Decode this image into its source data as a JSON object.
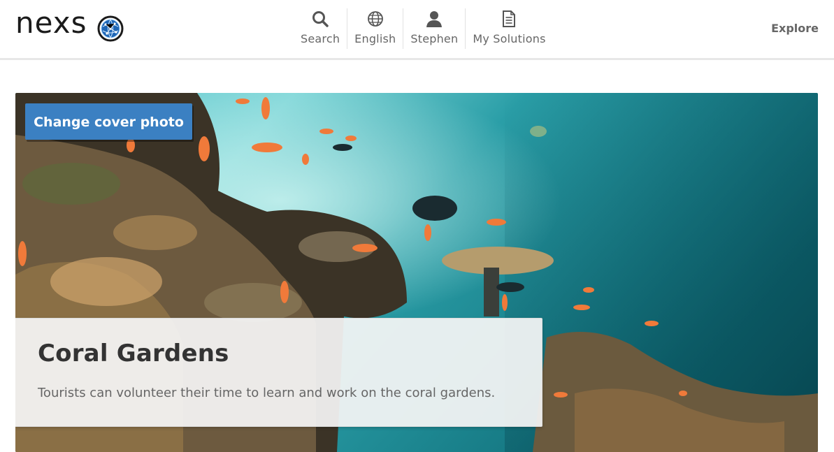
{
  "header": {
    "logo_text": "nexs",
    "nav": [
      {
        "label": "Search",
        "icon": "search-icon"
      },
      {
        "label": "English",
        "icon": "globe-icon"
      },
      {
        "label": "Stephen",
        "icon": "user-icon"
      },
      {
        "label": "My Solutions",
        "icon": "document-icon"
      }
    ],
    "explore_label": "Explore"
  },
  "cover": {
    "change_button_label": "Change cover photo",
    "image": "underwater coral reef photo"
  },
  "project": {
    "title": "Coral Gardens",
    "description": "Tourists can volunteer their time to learn and work on the coral gardens."
  },
  "colors": {
    "accent": "#3b80c2",
    "text_dark": "#333333",
    "text_muted": "#666666"
  }
}
